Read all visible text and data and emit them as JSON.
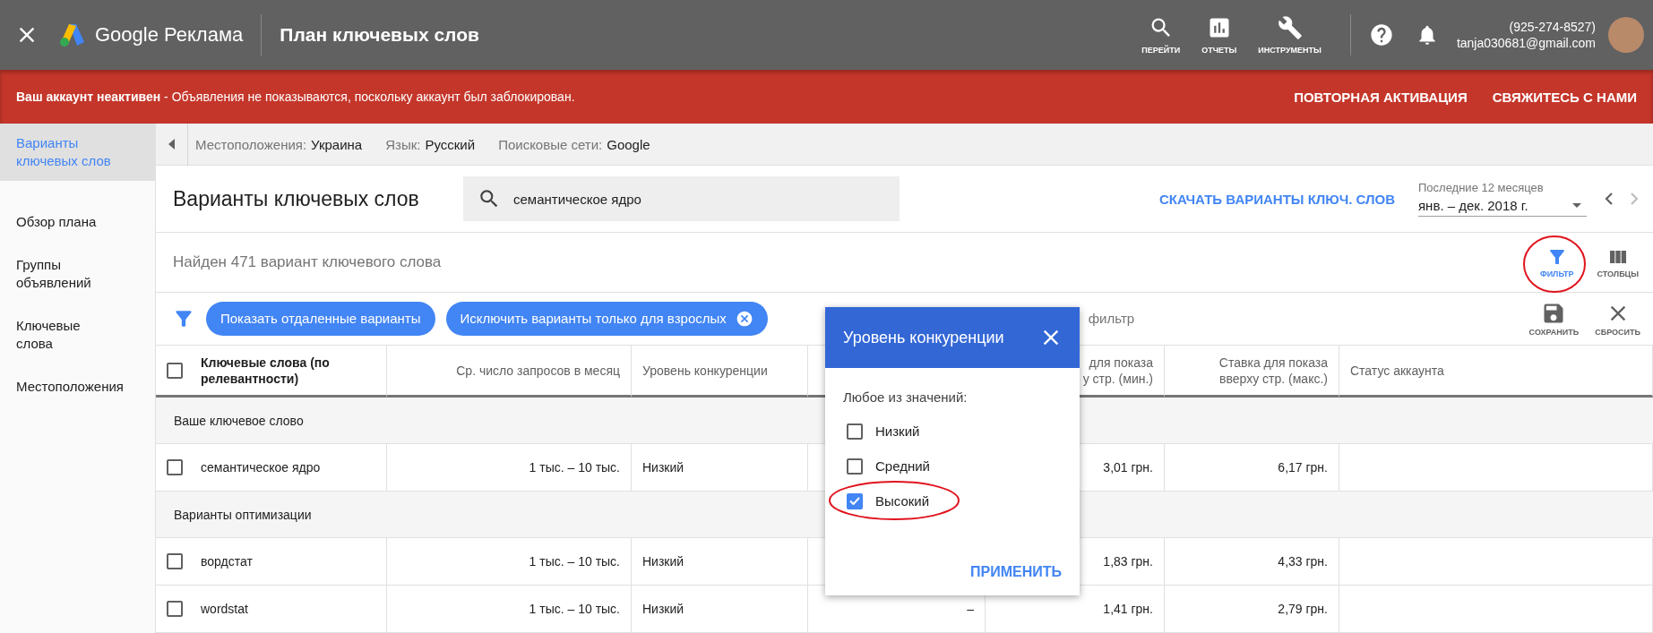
{
  "top_bar": {
    "brand": "Google Реклама",
    "title": "План ключевых слов",
    "nav": [
      {
        "kind": "search",
        "label": "ПЕРЕЙТИ"
      },
      {
        "kind": "reports",
        "label": "ОТЧЕТЫ"
      },
      {
        "kind": "tools",
        "label": "ИНСТРУМЕНТЫ"
      }
    ],
    "phone": "(925-274-8527)",
    "email": "tanja030681@gmail.com"
  },
  "banner": {
    "message": "**Ваш аккаунт неактивен** - Объявления не показываются, поскольку аккаунт был заблокирован.",
    "actions": [
      "ПОВТОРНАЯ АКТИВАЦИЯ",
      "СВЯЖИТЕСЬ С НАМИ"
    ]
  },
  "sidebar": {
    "items": [
      {
        "label": "Варианты\nключевых слов",
        "selected": true
      },
      {
        "label": "Обзор плана",
        "selected": false
      },
      {
        "label": "Группы\nобъявлений",
        "selected": false
      },
      {
        "label": "Ключевые\nслова",
        "selected": false
      },
      {
        "label": "Местоположения",
        "selected": false
      }
    ]
  },
  "targeting": [
    {
      "label": "Местоположения:",
      "value": "Украина"
    },
    {
      "label": "Язык:",
      "value": "Русский"
    },
    {
      "label": "Поисковые сети:",
      "value": "Google"
    }
  ],
  "header": {
    "title": "Варианты ключевых слов",
    "search_value": "семантическое ядро",
    "download": "СКАЧАТЬ ВАРИАНТЫ КЛЮЧ. СЛОВ",
    "period_label": "Последние 12 месяцев",
    "period": "янв. – дек. 2018 г."
  },
  "count": "Найден 471 вариант ключевого слова",
  "view_tools": [
    {
      "kind": "filter",
      "label": "ФИЛЬТР",
      "selected": true,
      "circled": true
    },
    {
      "kind": "columns",
      "label": "СТОЛБЦЫ",
      "selected": false,
      "circled": false
    }
  ],
  "filters": {
    "chips": [
      {
        "label": "Показать отдаленные варианты",
        "removable": false
      },
      {
        "label": "Исключить варианты только для взрослых",
        "removable": true
      }
    ],
    "add_text": "фильтр",
    "actions": [
      {
        "kind": "save",
        "label": "СОХРАНИТЬ"
      },
      {
        "kind": "reset",
        "label": "СБРОСИТЬ"
      }
    ]
  },
  "table": {
    "header_checked": false,
    "columns": [
      "Ключевые слова (по\nрелевантности)",
      "Ср. число запросов в месяц",
      "Уровень конкуренции",
      null,
      "для показа\nу стр. (мин.)",
      "Ставка для показа\nвверху стр. (макс.)",
      "Статус аккаунта"
    ],
    "rows": [
      {
        "kind": "group",
        "label": "Ваше ключевое слово"
      },
      {
        "kind": "keyword",
        "checked": false,
        "cells": [
          "семантическое ядро",
          "1 тыс. – 10 тыс.",
          "Низкий",
          null,
          "3,01 грн.",
          "6,17 грн.",
          null
        ]
      },
      {
        "kind": "group",
        "label": "Варианты оптимизации"
      },
      {
        "kind": "keyword",
        "checked": false,
        "cells": [
          "вордстат",
          "1 тыс. – 10 тыс.",
          "Низкий",
          null,
          "1,83 грн.",
          "4,33 грн.",
          null
        ]
      },
      {
        "kind": "keyword",
        "checked": false,
        "cells": [
          "wordstat",
          "1 тыс. – 10 тыс.",
          "Низкий",
          "–",
          "1,41 грн.",
          "2,79 грн.",
          null
        ]
      }
    ]
  },
  "popup": {
    "title": "Уровень конкуренции",
    "prompt": "Любое из значений:",
    "options": [
      {
        "label": "Низкий",
        "checked": false,
        "circled": false
      },
      {
        "label": "Средний",
        "checked": false,
        "circled": false
      },
      {
        "label": "Высокий",
        "checked": true,
        "circled": true
      }
    ],
    "apply": "ПРИМЕНИТЬ"
  }
}
